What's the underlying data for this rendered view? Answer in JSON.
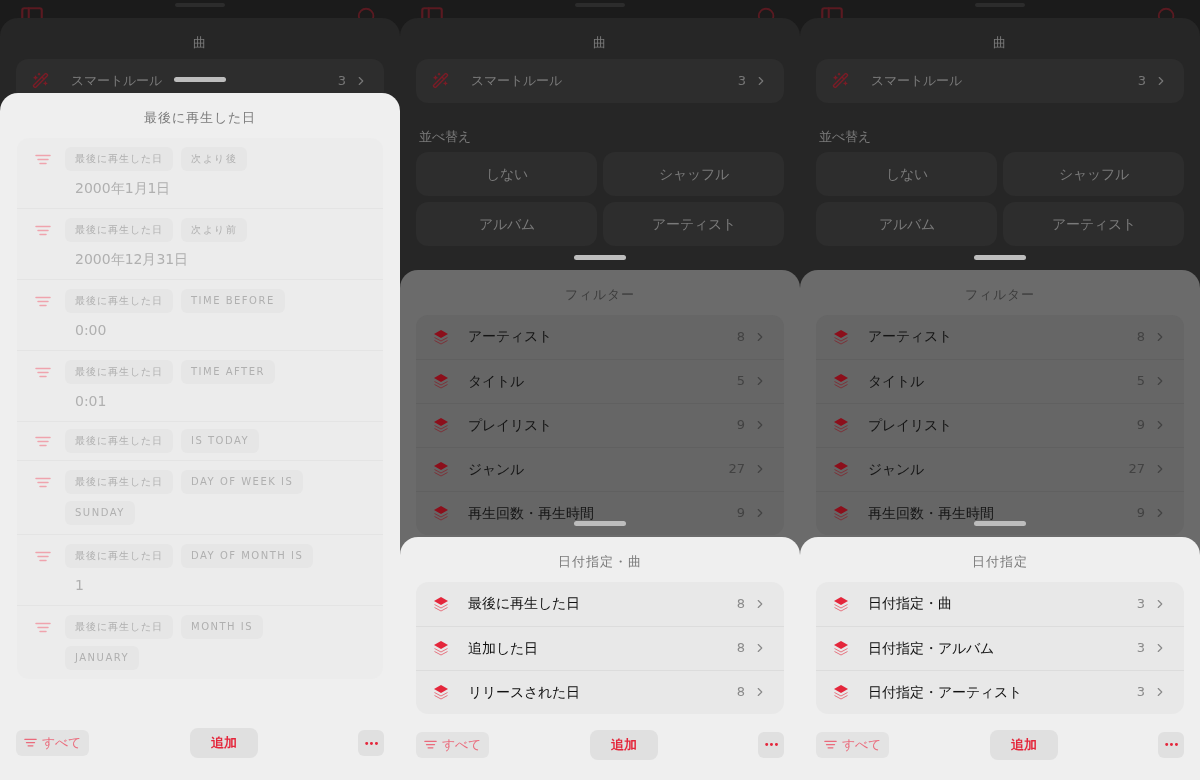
{
  "panels": [
    {
      "layers": [
        {
          "kind": "base",
          "title": "曲",
          "smart_rule": {
            "label": "スマートルール",
            "count": "3"
          }
        },
        {
          "kind": "rules",
          "title": "最後に再生した日",
          "rules": [
            {
              "kind": "text",
              "field": "最後に再生した日",
              "condition": "次より後",
              "value": "2000年1月1日",
              "disabled": true
            },
            {
              "kind": "text",
              "field": "最後に再生した日",
              "condition": "次より前",
              "value": "2000年12月31日",
              "disabled": true
            },
            {
              "kind": "text",
              "field": "最後に再生した日",
              "condition": "TIME BEFORE",
              "value": "0:00",
              "disabled": true
            },
            {
              "kind": "text",
              "field": "最後に再生した日",
              "condition": "TIME AFTER",
              "value": "0:01",
              "disabled": true
            },
            {
              "kind": "plain",
              "field": "最後に再生した日",
              "condition": "IS TODAY",
              "disabled": true
            },
            {
              "kind": "chip",
              "field": "最後に再生した日",
              "condition": "DAY OF WEEK IS",
              "value": "SUNDAY",
              "disabled": true
            },
            {
              "kind": "text",
              "field": "最後に再生した日",
              "condition": "DAY OF MONTH IS",
              "value": "1",
              "disabled": true
            },
            {
              "kind": "chip",
              "field": "最後に再生した日",
              "condition": "MONTH IS",
              "value": "JANUARY",
              "disabled": true
            }
          ],
          "toolbar": {
            "filter_button": "すべて",
            "add_button": "追加",
            "more_button": "•••"
          }
        }
      ]
    },
    {
      "layers": [
        {
          "kind": "base",
          "title": "曲",
          "smart_rule": {
            "label": "スマートルール",
            "count": "3"
          },
          "sort": {
            "heading": "並べ替え",
            "options": [
              "しない",
              "シャッフル",
              "アルバム",
              "アーティスト"
            ]
          }
        },
        {
          "kind": "menu",
          "title": "フィルター",
          "items": [
            {
              "label": "アーティスト",
              "count": "8"
            },
            {
              "label": "タイトル",
              "count": "5"
            },
            {
              "label": "プレイリスト",
              "count": "9"
            },
            {
              "label": "ジャンル",
              "count": "27"
            },
            {
              "label": "再生回数・再生時間",
              "count": "9"
            }
          ]
        },
        {
          "kind": "menu",
          "title": "日付指定・曲",
          "items": [
            {
              "label": "最後に再生した日",
              "count": "8"
            },
            {
              "label": "追加した日",
              "count": "8"
            },
            {
              "label": "リリースされた日",
              "count": "8"
            }
          ],
          "toolbar": {
            "filter_button": "すべて",
            "add_button": "追加",
            "more_button": "•••"
          }
        }
      ]
    },
    {
      "layers": [
        {
          "kind": "base",
          "title": "曲",
          "smart_rule": {
            "label": "スマートルール",
            "count": "3"
          },
          "sort": {
            "heading": "並べ替え",
            "options": [
              "しない",
              "シャッフル",
              "アルバム",
              "アーティスト"
            ]
          }
        },
        {
          "kind": "menu",
          "title": "フィルター",
          "items": [
            {
              "label": "アーティスト",
              "count": "8"
            },
            {
              "label": "タイトル",
              "count": "5"
            },
            {
              "label": "プレイリスト",
              "count": "9"
            },
            {
              "label": "ジャンル",
              "count": "27"
            },
            {
              "label": "再生回数・再生時間",
              "count": "9"
            }
          ]
        },
        {
          "kind": "menu",
          "title": "日付指定",
          "items": [
            {
              "label": "日付指定・曲",
              "count": "3"
            },
            {
              "label": "日付指定・アルバム",
              "count": "3"
            },
            {
              "label": "日付指定・アーティスト",
              "count": "3"
            }
          ],
          "toolbar": {
            "filter_button": "すべて",
            "add_button": "追加",
            "more_button": "•••"
          }
        }
      ]
    }
  ]
}
